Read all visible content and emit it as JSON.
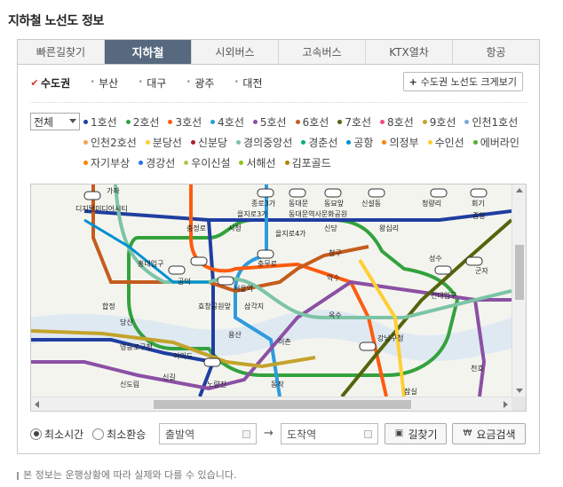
{
  "page_title": "지하철 노선도 정보",
  "tabs": [
    {
      "label": "빠른길찾기",
      "active": false
    },
    {
      "label": "지하철",
      "active": true
    },
    {
      "label": "시외버스",
      "active": false
    },
    {
      "label": "고속버스",
      "active": false
    },
    {
      "label": "KTX열차",
      "active": false
    },
    {
      "label": "항공",
      "active": false
    }
  ],
  "regions": [
    {
      "label": "수도권",
      "active": true
    },
    {
      "label": "부산",
      "active": false
    },
    {
      "label": "대구",
      "active": false
    },
    {
      "label": "광주",
      "active": false
    },
    {
      "label": "대전",
      "active": false
    }
  ],
  "enlarge_button": "수도권 노선도 크게보기",
  "line_filter_value": "전체",
  "lines": [
    {
      "label": "1호선",
      "color": "#1f3ea0"
    },
    {
      "label": "2호선",
      "color": "#33a23d"
    },
    {
      "label": "3호선",
      "color": "#fe5b10"
    },
    {
      "label": "4호선",
      "color": "#2f9bdc"
    },
    {
      "label": "5호선",
      "color": "#8b50a4"
    },
    {
      "label": "6호선",
      "color": "#c55c1d"
    },
    {
      "label": "7호선",
      "color": "#54640d"
    },
    {
      "label": "8호선",
      "color": "#f14c82"
    },
    {
      "label": "9호선",
      "color": "#c3a32a"
    },
    {
      "label": "인천1호선",
      "color": "#7ca8d5"
    },
    {
      "label": "인천2호선",
      "color": "#f5a251"
    },
    {
      "label": "분당선",
      "color": "#ffce33"
    },
    {
      "label": "신분당",
      "color": "#a71e31"
    },
    {
      "label": "경의중앙선",
      "color": "#7cc4a5"
    },
    {
      "label": "경춘선",
      "color": "#08af7b"
    },
    {
      "label": "공항",
      "color": "#0090d2"
    },
    {
      "label": "의정부",
      "color": "#fd8100"
    },
    {
      "label": "수인선",
      "color": "#ffce33"
    },
    {
      "label": "에버라인",
      "color": "#56ad2d"
    },
    {
      "label": "자기부상",
      "color": "#fd8100"
    },
    {
      "label": "경강선",
      "color": "#2673f2"
    },
    {
      "label": "우이신설",
      "color": "#b7c452"
    },
    {
      "label": "서해선",
      "color": "#8fc31f"
    },
    {
      "label": "김포골드",
      "color": "#ad8605"
    }
  ],
  "map_stations": [
    {
      "label": "종로3가",
      "key": "jongno3"
    },
    {
      "label": "동대문",
      "key": "dongdaemun"
    },
    {
      "label": "동묘앞",
      "key": "dongmyo"
    },
    {
      "label": "신설동",
      "key": "sinseol"
    },
    {
      "label": "청량리",
      "key": "cheongnyangni"
    },
    {
      "label": "회기",
      "key": "hoegi"
    },
    {
      "label": "가좌",
      "key": "gajwa"
    },
    {
      "label": "디지털미디어시티",
      "key": "dmc"
    },
    {
      "label": "을지로3가",
      "key": "euljiro3"
    },
    {
      "label": "을지로4가",
      "key": "euljiro4"
    },
    {
      "label": "동대문역사문화공원",
      "key": "ddp"
    },
    {
      "label": "충정로",
      "key": "chungjeongno"
    },
    {
      "label": "시청",
      "key": "cityhall"
    },
    {
      "label": "신당",
      "key": "sindang"
    },
    {
      "label": "왕십리",
      "key": "wangsimni"
    },
    {
      "label": "홍대입구",
      "key": "hongdae"
    },
    {
      "label": "충무로",
      "key": "chungmuro"
    },
    {
      "label": "청구",
      "key": "cheonggu"
    },
    {
      "label": "서울역",
      "key": "seoulstation"
    },
    {
      "label": "공덕",
      "key": "gongdeok"
    },
    {
      "label": "약수",
      "key": "yaksu"
    },
    {
      "label": "성수",
      "key": "seongsu"
    },
    {
      "label": "건대입구",
      "key": "konkuk"
    },
    {
      "label": "군자",
      "key": "gunja"
    },
    {
      "label": "합정",
      "key": "hapjeong"
    },
    {
      "label": "효창공원앞",
      "key": "hyochang"
    },
    {
      "label": "삼각지",
      "key": "samgakji"
    },
    {
      "label": "옥수",
      "key": "oksu"
    },
    {
      "label": "당산",
      "key": "dangsan"
    },
    {
      "label": "용산",
      "key": "yongsan"
    },
    {
      "label": "이촌",
      "key": "ichon"
    },
    {
      "label": "강남구청",
      "key": "gangnamgu"
    },
    {
      "label": "영등포구청",
      "key": "yeongdeungpogu"
    },
    {
      "label": "여의도",
      "key": "yeouido"
    },
    {
      "label": "신길",
      "key": "singil"
    },
    {
      "label": "신도림",
      "key": "sindorim"
    },
    {
      "label": "노량진",
      "key": "noryangjin"
    },
    {
      "label": "동작",
      "key": "dongjak"
    },
    {
      "label": "천호",
      "key": "cheonho"
    },
    {
      "label": "잠실",
      "key": "jamsil"
    },
    {
      "label": "중앙",
      "key": "jungang"
    }
  ],
  "route_type_options": [
    {
      "label": "최소시간",
      "selected": true
    },
    {
      "label": "최소환승",
      "selected": false
    }
  ],
  "departure_placeholder": "출발역",
  "arrival_placeholder": "도착역",
  "route_arrow": "→",
  "route_button": "길찾기",
  "fare_button": "요금검색",
  "notice": "본 정보는 운행상황에 따라 실제와 다를 수 있습니다."
}
